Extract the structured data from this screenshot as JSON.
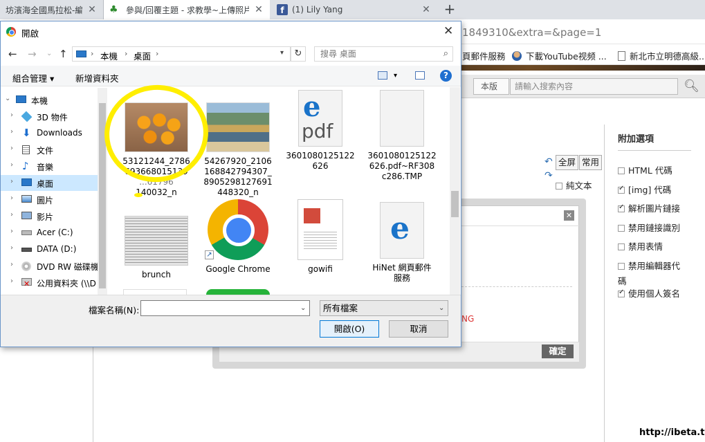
{
  "browser": {
    "tabs": [
      {
        "label": "坊濱海全國馬拉松-編輯",
        "close": "✕"
      },
      {
        "label": "參與/回覆主題 - 求教學~上傳照片",
        "close": "✕"
      },
      {
        "label": "(1) Lily Yang",
        "close": "✕",
        "favicon_letter": "f"
      }
    ],
    "new_tab": "+",
    "url_tail": "1849310&extra=&page=1",
    "bookmarks": [
      {
        "label": "頁郵件服務"
      },
      {
        "label": "下載YouTube视频 ..."
      },
      {
        "label": "新北市立明德高級..."
      }
    ]
  },
  "forum": {
    "search_scope": "本版",
    "search_placeholder": "請輸入搜索內容",
    "editor_buttons": {
      "fullscreen": "全屏",
      "common": "常用"
    },
    "plain_text_label": "純文本",
    "options_title": "附加選項",
    "options": [
      {
        "label": "HTML 代碼",
        "checked": false
      },
      {
        "label": "[img] 代碼",
        "checked": true
      },
      {
        "label": "解析圖片鏈接",
        "checked": true
      },
      {
        "label": "禁用鏈接識別",
        "checked": false
      },
      {
        "label": "禁用表情",
        "checked": false
      },
      {
        "label": "禁用編輯器代",
        "checked": false,
        "wrap": "碼"
      },
      {
        "label": "使用個人簽名",
        "checked": true
      }
    ],
    "modal_close": "✕",
    "modal_red_text": "NG",
    "modal_ok": "確定",
    "watermark": "http://ibeta.tw"
  },
  "dialog": {
    "title": "開啟",
    "close": "✕",
    "breadcrumb": [
      "本機",
      "桌面"
    ],
    "search_placeholder": "搜尋 桌面",
    "organize": "組合管理 ▾",
    "new_folder": "新增資料夾",
    "help": "?",
    "tree": [
      {
        "label": "本機",
        "icon": "pc-icon",
        "level": 0,
        "expanded": true
      },
      {
        "label": "3D 物件",
        "icon": "3d-objects-icon",
        "level": 1
      },
      {
        "label": "Downloads",
        "icon": "downloads-icon",
        "level": 1
      },
      {
        "label": "文件",
        "icon": "documents-icon",
        "level": 1
      },
      {
        "label": "音樂",
        "icon": "music-icon",
        "level": 1
      },
      {
        "label": "桌面",
        "icon": "desktop-icon",
        "level": 1,
        "selected": true
      },
      {
        "label": "圖片",
        "icon": "pictures-icon",
        "level": 1
      },
      {
        "label": "影片",
        "icon": "videos-icon",
        "level": 1
      },
      {
        "label": "Acer (C:)",
        "icon": "drive-icon",
        "level": 1
      },
      {
        "label": "DATA (D:)",
        "icon": "drive-icon",
        "level": 1
      },
      {
        "label": "DVD RW 磁碟機",
        "icon": "dvd-icon",
        "level": 1
      },
      {
        "label": "公用資料夾 (\\\\D",
        "icon": "network-folder-icon",
        "level": 1
      }
    ],
    "files": [
      {
        "name": "53121244_2786693668015139 ...61796 140032_n",
        "line1": "53121244_2786",
        "line2": "693668015139",
        "line3": "...61796",
        "line4": "140032_n",
        "icon": "image-thumbnail-oranges"
      },
      {
        "line1": "54267920_2106",
        "line2": "168842794307_",
        "line3": "8905298127691",
        "line4": "448320_n",
        "icon": "image-thumbnail-group"
      },
      {
        "line1": "3601080125122",
        "line2": "626",
        "icon": "pdf-icon"
      },
      {
        "line1": "3601080125122",
        "line2": "626.pdf~RF308",
        "line3": "c286.TMP",
        "icon": "blank-file-icon"
      },
      {
        "line1": "brunch",
        "icon": "image-thumbnail-doc"
      },
      {
        "line1": "Google Chrome",
        "icon": "chrome-icon"
      },
      {
        "line1": "gowifi",
        "icon": "image-thumbnail-gowifi"
      },
      {
        "line1": "HiNet 網頁郵件",
        "line2": "服務",
        "icon": "ie-shortcut-icon"
      }
    ],
    "filename_label": "檔案名稱(N):",
    "filename_value": "",
    "filetype": "所有檔案",
    "open_button": "開啟(O)",
    "cancel_button": "取消"
  }
}
